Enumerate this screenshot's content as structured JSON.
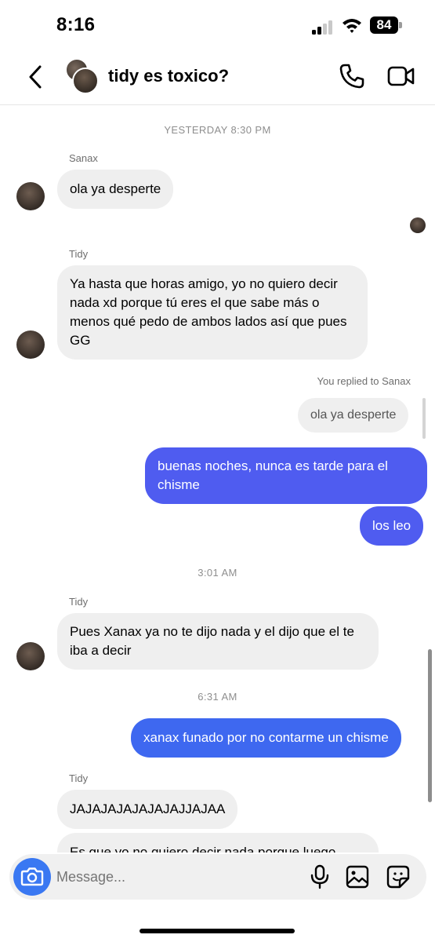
{
  "status": {
    "time": "8:16",
    "battery": "84"
  },
  "header": {
    "title": "tidy es toxico?"
  },
  "messages": {
    "ts_yesterday": "YESTERDAY 8:30 PM",
    "sender_sanax": "Sanax",
    "msg1": "ola ya desperte",
    "sender_tidy_1": "Tidy",
    "msg2": "Ya hasta que horas amigo, yo no quiero decir nada xd porque tú eres el que sabe más o menos qué pedo de ambos lados así que pues GG",
    "reply_label": "You replied to Sanax",
    "reply_quote": "ola ya desperte",
    "msg3": "buenas noches, nunca es tarde para el chisme",
    "msg4": "los leo",
    "ts_301": "3:01 AM",
    "sender_tidy_2": "Tidy",
    "msg5": "Pues Xanax ya no te dijo nada y el dijo que el te iba a decir",
    "ts_631": "6:31 AM",
    "msg6": "xanax funado por no contarme un chisme",
    "sender_tidy_3": "Tidy",
    "msg7": "JAJAJAJAJAJAJAJJAJAA",
    "msg8": "Es que yo no quiero decir nada porque luego"
  },
  "composer": {
    "placeholder": "Message..."
  },
  "colors": {
    "accent_purple": "#4f5cf0",
    "accent_blue": "#3e68f0",
    "camera_blue": "#3a78f2",
    "incoming_bg": "#efefef"
  },
  "icons": [
    "back-chevron-icon",
    "phone-icon",
    "video-camera-icon",
    "camera-icon",
    "microphone-icon",
    "gallery-icon",
    "sticker-icon"
  ]
}
